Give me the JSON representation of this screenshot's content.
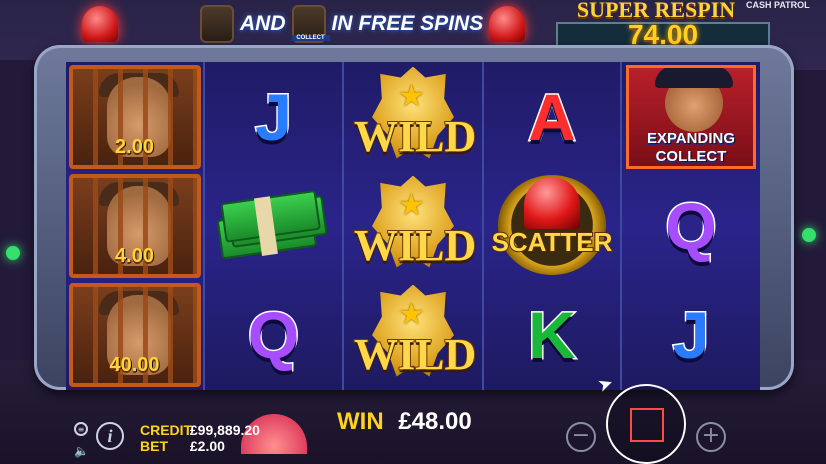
{
  "banner": {
    "and_text": "AND",
    "collect_label": "COLLECT",
    "in_free_spins": "IN FREE SPINS"
  },
  "super_respin": {
    "title": "SUPER RESPIN",
    "value": "74.00"
  },
  "game_logo": "CASH PATROL",
  "reels": {
    "reel1": [
      {
        "symbol": "prisoner",
        "value": "2.00"
      },
      {
        "symbol": "prisoner",
        "value": "4.00"
      },
      {
        "symbol": "prisoner",
        "value": "40.00"
      }
    ],
    "reel2": [
      {
        "symbol": "J"
      },
      {
        "symbol": "cash"
      },
      {
        "symbol": "Q"
      }
    ],
    "reel3": [
      {
        "symbol": "WILD"
      },
      {
        "symbol": "WILD"
      },
      {
        "symbol": "WILD"
      }
    ],
    "reel4": [
      {
        "symbol": "A"
      },
      {
        "symbol": "SCATTER"
      },
      {
        "symbol": "K"
      }
    ],
    "reel5": [
      {
        "symbol": "collect",
        "line1": "EXPANDING",
        "line2": "COLLECT"
      },
      {
        "symbol": "Q"
      },
      {
        "symbol": "J"
      }
    ]
  },
  "hud": {
    "credit_label": "CREDIT",
    "credit_value": "£99,889.20",
    "bet_label": "BET",
    "bet_value": "£2.00",
    "win_label": "WIN",
    "win_value": "£48.00",
    "minus": "−",
    "plus": "+",
    "info": "i"
  },
  "colors": {
    "accent": "#ffd21f",
    "reel_bg": "#221d72",
    "cage": "#c25a1e"
  }
}
